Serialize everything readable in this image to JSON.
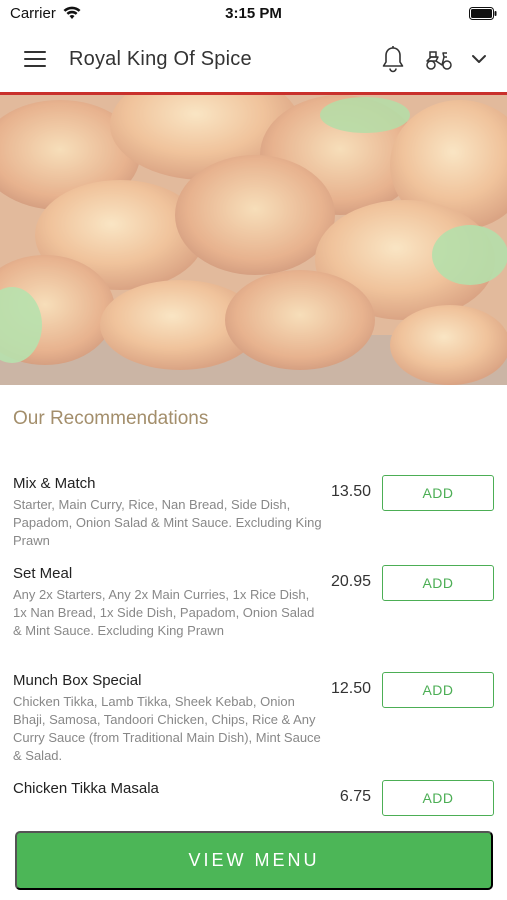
{
  "status_bar": {
    "carrier": "Carrier",
    "time": "3:15 PM"
  },
  "header": {
    "title": "Royal King Of Spice"
  },
  "section": {
    "title": "Our Recommendations"
  },
  "menu_items": [
    {
      "name": "Mix & Match",
      "description": "Starter, Main Curry, Rice, Nan Bread, Side Dish, Papadom, Onion Salad & Mint Sauce. Excluding King Prawn",
      "price": "13.50",
      "add_label": "ADD"
    },
    {
      "name": "Set Meal",
      "description": "Any 2x Starters, Any 2x Main Curries, 1x Rice Dish, 1x Nan Bread, 1x Side Dish, Papadom, Onion Salad & Mint Sauce. Excluding King Prawn",
      "price": "20.95",
      "add_label": "ADD"
    },
    {
      "name": "Munch Box Special",
      "description": "Chicken Tikka, Lamb Tikka, Sheek Kebab, Onion Bhaji, Samosa, Tandoori Chicken, Chips, Rice & Any Curry Sauce (from Traditional Main Dish), Mint Sauce & Salad.",
      "price": "12.50",
      "add_label": "ADD"
    },
    {
      "name": "Chicken Tikka Masala",
      "description": "",
      "price": "6.75",
      "add_label": "ADD"
    }
  ],
  "view_menu_label": "VIEW MENU",
  "colors": {
    "accent_green": "#4cb657",
    "header_line": "#c9302c",
    "section_title": "#a38e6b"
  }
}
